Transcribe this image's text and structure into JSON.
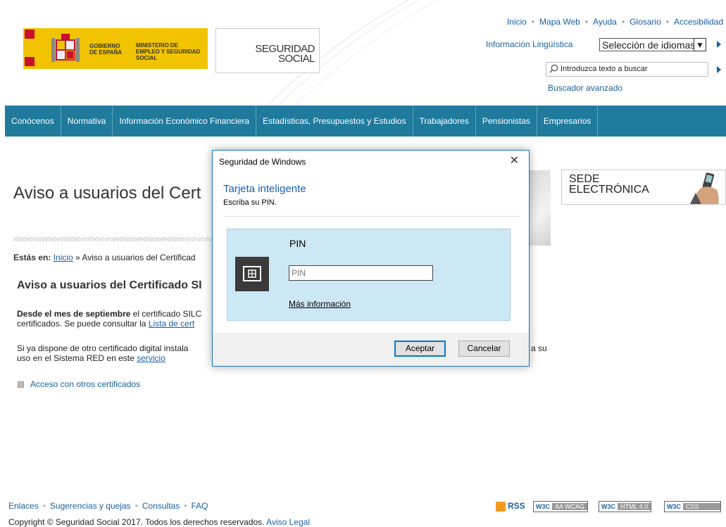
{
  "header": {
    "gov_text_1": "GOBIERNO DE ESPAÑA",
    "gov_text_2": "MINISTERIO DE EMPLEO Y SEGURIDAD SOCIAL",
    "logo_text": "SEGURIDAD SOCIAL",
    "top_links": [
      "Inicio",
      "Mapa Web",
      "Ayuda",
      "Glosario",
      "Accesibilidad"
    ],
    "info_linguistica": "Información Lingüística",
    "language_select": "Selección de idiomas",
    "search_placeholder": "Introduzca texto a buscar",
    "advanced_search": "Buscador avanzado"
  },
  "nav": [
    "Conócenos",
    "Normativa",
    "Información Económico Financiera",
    "Estadísticas, Presupuestos y Estudios",
    "Trabajadores",
    "Pensionistas",
    "Empresarios"
  ],
  "content": {
    "title": "Aviso a usuarios del Cert",
    "breadcrumb_label": "Estás en:",
    "breadcrumb_home": "Inicio",
    "breadcrumb_current": "» Aviso a usuarios del Certificad",
    "heading": "Aviso a usuarios del Certificado SI",
    "p1_bold": "Desde el mes de septiembre",
    "p1_rest": " el certificado SILC",
    "p1_line2_pre": "certificados. Se puede consultar la ",
    "p1_line2_link": "Lista de cert",
    "p2_line1": "Si ya dispone de otro certificado digital instala",
    "p2_line1_right": "a su",
    "p2_line2_pre": "uso en el Sistema RED en este ",
    "p2_line2_link": "servicio",
    "bullet_link": "Acceso con otros certificados",
    "sede_line1": "SEDE",
    "sede_line2": "ELECTRÓNICA"
  },
  "footer": {
    "links": [
      "Enlaces",
      "Sugerencias y quejas",
      "Consultas",
      "FAQ"
    ],
    "copyright": "Copyright © Seguridad Social 2017. Todos los derechos reservados.",
    "legal": "Aviso Legal",
    "rss": "RSS",
    "badges": [
      {
        "w3": "W3C",
        "text": "AA WCAG"
      },
      {
        "w3": "W3C",
        "text": "HTML 4.0"
      },
      {
        "w3": "W3C",
        "text": "CSS"
      }
    ]
  },
  "dialog": {
    "window_title": "Seguridad de Windows",
    "close": "✕",
    "heading": "Tarjeta inteligente",
    "subheading": "Escriba su PIN.",
    "pin_label": "PIN",
    "pin_placeholder": "PIN",
    "more_info": "Más información",
    "ok": "Aceptar",
    "cancel": "Cancelar",
    "accent": "#0078d7",
    "panel_color": "#cce8f7"
  },
  "colors": {
    "nav_bg": "#1f7a9c",
    "link": "#1a5f9e",
    "gov_yellow": "#f1c300"
  }
}
